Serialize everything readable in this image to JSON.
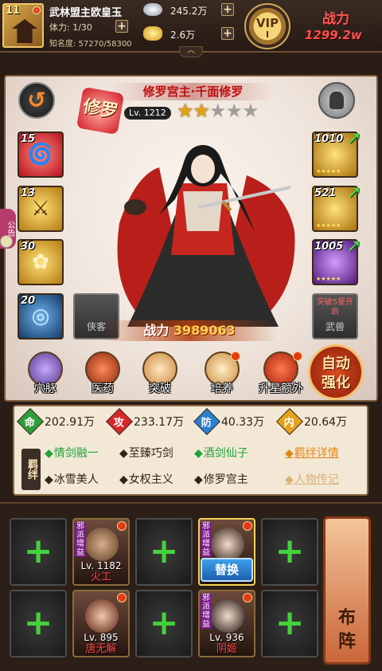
{
  "player": {
    "level": "11",
    "name": "武林盟主欧皇玉",
    "stamina": "体力: 1/30",
    "fame": "知名度: 57270/58300"
  },
  "resources": {
    "silver": "245.2万",
    "gold": "2.6万"
  },
  "vip": {
    "label": "VIP",
    "level": "I"
  },
  "power": {
    "title": "战力",
    "value": "1299.2w"
  },
  "hero": {
    "faction": "修罗",
    "title": "修罗宫主·千面修罗",
    "level": "Lv. 1212",
    "stars": 2,
    "stars_max": 5,
    "combat_power_label": "战力",
    "combat_power_value": "3989063"
  },
  "skills": [
    {
      "num": "15",
      "color": "#e0303a"
    },
    {
      "num": "13",
      "color": "#e3a31a"
    },
    {
      "num": "30",
      "color": "#e3a31a"
    },
    {
      "num": "20",
      "color": "#2a6ea8"
    }
  ],
  "equipment": [
    {
      "num": "1010",
      "color": "#e3a31a"
    },
    {
      "num": "521",
      "color": "#e3a31a"
    },
    {
      "num": "1005",
      "color": "#8a3ab8"
    }
  ],
  "slots": {
    "companion": "侠客",
    "beast": "武兽",
    "beast_hint": "突破5星开启"
  },
  "side_tab": "公告",
  "functions": [
    {
      "label": "穴脉",
      "badge": false
    },
    {
      "label": "医药",
      "badge": false
    },
    {
      "label": "突破",
      "badge": false
    },
    {
      "label": "培养",
      "badge": true
    },
    {
      "label": "升星额外",
      "badge": true
    }
  ],
  "auto_strengthen": {
    "line1": "自动",
    "line2": "强化"
  },
  "stats": [
    {
      "badge": "命",
      "value": "202.91万",
      "color": "#2f9e3a"
    },
    {
      "badge": "攻",
      "value": "233.17万",
      "color": "#d9262a"
    },
    {
      "badge": "防",
      "value": "40.33万",
      "color": "#2a7fd0"
    },
    {
      "badge": "内",
      "value": "20.64万",
      "color": "#e6a21c"
    }
  ],
  "bonds": {
    "label": "羁绊",
    "items": [
      {
        "text": "情剑融一",
        "active": true
      },
      {
        "text": "至臻巧剑",
        "active": false
      },
      {
        "text": "酒剑仙子",
        "active": true
      },
      {
        "text": "冰雪美人",
        "active": false
      },
      {
        "text": "女权主义",
        "active": false
      },
      {
        "text": "修罗宫主",
        "active": false
      }
    ],
    "details_link": "羁绊详情",
    "bio_link": "人物传记"
  },
  "formation": {
    "heroes": [
      {
        "level": "Lv. 1182",
        "name": "火工",
        "tag": "邪派增益"
      },
      {
        "level": "",
        "name": "",
        "tag": "邪派增益"
      },
      {
        "level": "Lv. 895",
        "name": "唐无解",
        "tag": ""
      },
      {
        "level": "Lv. 936",
        "name": "阴姬",
        "tag": "邪派增益"
      }
    ],
    "swap_label": "替换",
    "layout_label_1": "布",
    "layout_label_2": "阵"
  }
}
